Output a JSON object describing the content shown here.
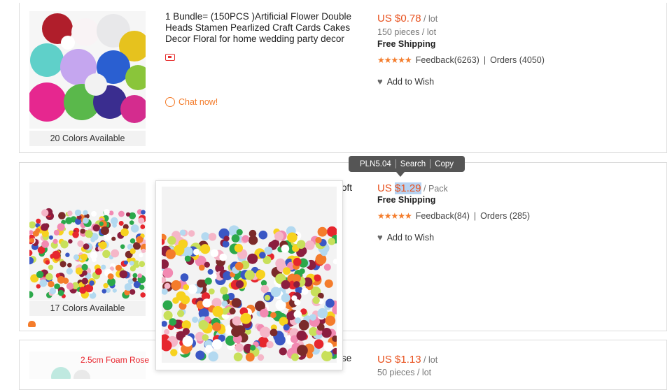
{
  "items": [
    {
      "title": "1 Bundle= (150PCS )Artificial Flower Double Heads Stamen Pearlized Craft Cards Cakes Decor Floral for home wedding party decor",
      "price_prefix": "US ",
      "price_value": "$0.78",
      "unit": " / lot",
      "pieces": "150 pieces / lot",
      "shipping": "Free Shipping",
      "feedback": "Feedback(6263)",
      "orders": "Orders (4050)",
      "wish": "Add to Wish",
      "colors": "20 Colors Available",
      "chat": "Chat now!"
    },
    {
      "title_fragment": "oft",
      "price_prefix": "US ",
      "price_value": "$1.29",
      "unit": " / Pack",
      "shipping": "Free Shipping",
      "feedback": "Feedback(84)",
      "orders": "Orders (285)",
      "wish": "Add to Wish",
      "colors": "17 Colors Available"
    },
    {
      "thumb_label": "2.5cm Foam Rose",
      "title_fragment": "se",
      "price_prefix": "US ",
      "price_value": "$1.13",
      "unit": " / lot",
      "pieces": "50 pieces / lot"
    }
  ],
  "tooltip": {
    "currency": "PLN5.04",
    "search": "Search",
    "copy": "Copy"
  },
  "separator": "|",
  "icons": {
    "star": "star-icon",
    "heart": "heart-icon",
    "chat": "chat-icon"
  },
  "colors": {
    "accent": "#e8511e",
    "star": "#f47c2b",
    "tooltip_bg": "#555555"
  }
}
